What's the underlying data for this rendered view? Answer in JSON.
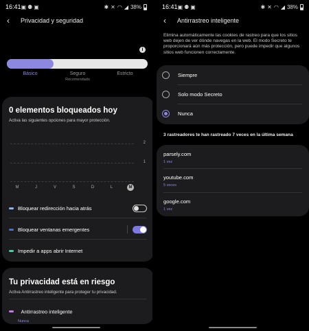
{
  "colors": {
    "accent": "#8c88e0",
    "card": "#1c1c1e",
    "redirect_dot": "#8fb4f0",
    "popup_dot": "#4a6fd0",
    "apps_dot": "#4ad0a0",
    "antitracking_dot": "#c77be8"
  },
  "left": {
    "status": {
      "time": "16:41",
      "battery": "38%"
    },
    "header": {
      "title": "Privacidad y seguridad"
    },
    "protection": {
      "level_fraction": 0.33,
      "levels": [
        {
          "label": "Básico",
          "sub": ""
        },
        {
          "label": "Seguro",
          "sub": "Recomendado"
        },
        {
          "label": "Estricto",
          "sub": ""
        }
      ]
    },
    "blocked_card": {
      "title": "0 elementos bloqueados hoy",
      "desc": "Activa las siguientes opciones para mayor protección."
    },
    "chart_data": {
      "type": "bar",
      "categories": [
        "M",
        "J",
        "V",
        "S",
        "D",
        "L",
        "M"
      ],
      "series": [
        {
          "values": [
            0,
            0,
            0,
            0,
            0,
            0,
            0
          ]
        }
      ],
      "ytick_labels": [
        "2",
        "1"
      ],
      "ylim": [
        0,
        2
      ],
      "highlighted_category_index": 6,
      "grid": true
    },
    "options": [
      {
        "label": "Bloquear redirección hacia atrás",
        "toggle": "off"
      },
      {
        "label": "Bloquear ventanas emergentes",
        "toggle": "on"
      },
      {
        "label": "Impedir a apps abrir Internet",
        "toggle": "none"
      }
    ],
    "risk_card": {
      "title": "Tu privacidad está en riesgo",
      "desc": "Activa Antirrastreo inteligente para proteger tu privacidad.",
      "item_label": "Antirrastreo inteligente",
      "item_value": "Nunca"
    }
  },
  "right": {
    "status": {
      "time": "16:41",
      "battery": "38%"
    },
    "header": {
      "title": "Antirrastreo inteligente"
    },
    "description": "Elimina automáticamente las cookies de rastreo para que los sitios web dejen de ver dónde navegas en la web. El modo Secreto te proporcionará aún más protección, pero puede impedir que algunos sitios web funcionen correctamente.",
    "options": [
      {
        "label": "Siempre",
        "selected": false
      },
      {
        "label": "Solo modo Secreto",
        "selected": false
      },
      {
        "label": "Nunca",
        "selected": true
      }
    ],
    "tracked_summary": "3 rastreadores te han rastreado 7 veces en la última semana",
    "trackers": [
      {
        "site": "parsely.com",
        "count": "1 vez"
      },
      {
        "site": "youtube.com",
        "count": "5 veces"
      },
      {
        "site": "google.com",
        "count": "1 vez"
      }
    ]
  }
}
